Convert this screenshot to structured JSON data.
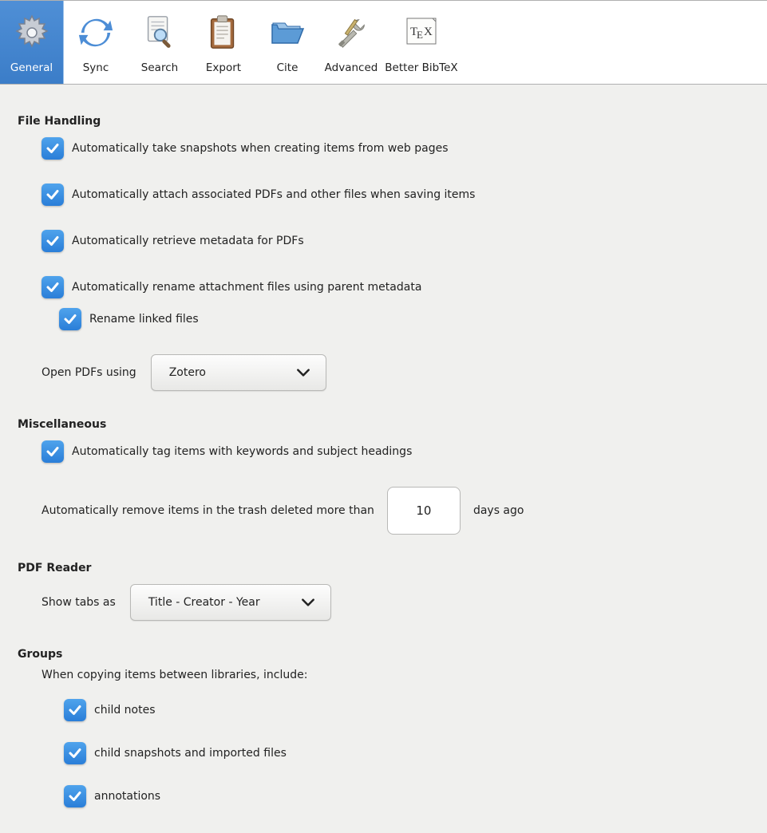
{
  "tabs": [
    {
      "label": "General"
    },
    {
      "label": "Sync"
    },
    {
      "label": "Search"
    },
    {
      "label": "Export"
    },
    {
      "label": "Cite"
    },
    {
      "label": "Advanced"
    },
    {
      "label": "Better BibTeX"
    }
  ],
  "sections": {
    "file_handling": {
      "title": "File Handling",
      "snapshot": "Automatically take snapshots when creating items from web pages",
      "attach_pdfs": "Automatically attach associated PDFs and other files when saving items",
      "retrieve_meta": "Automatically retrieve metadata for PDFs",
      "rename_attach": "Automatically rename attachment files using parent metadata",
      "rename_linked": "Rename linked files",
      "open_pdfs_label": "Open PDFs using",
      "open_pdfs_value": "Zotero"
    },
    "misc": {
      "title": "Miscellaneous",
      "auto_tag": "Automatically tag items with keywords and subject headings",
      "trash_prefix": "Automatically remove items in the trash deleted more than",
      "trash_days": "10",
      "trash_suffix": "days ago"
    },
    "pdf_reader": {
      "title": "PDF Reader",
      "show_tabs_label": "Show tabs as",
      "show_tabs_value": "Title - Creator - Year"
    },
    "groups": {
      "title": "Groups",
      "intro": "When copying items between libraries, include:",
      "child_notes": "child notes",
      "child_snapshots": "child snapshots and imported files",
      "annotations": "annotations"
    }
  }
}
